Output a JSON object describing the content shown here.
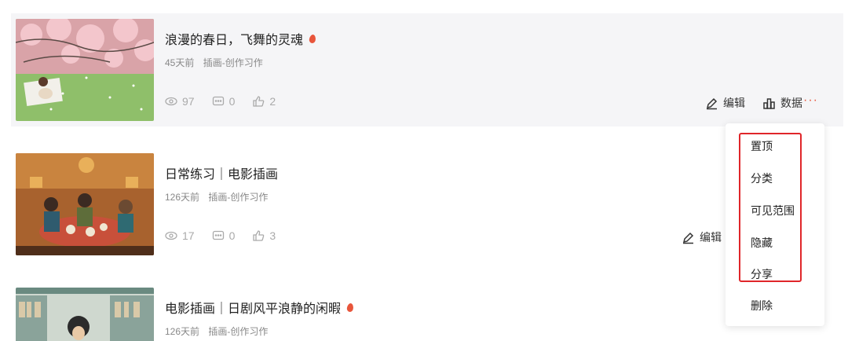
{
  "colors": {
    "accent": "#e8553b",
    "highlight_box": "#e0262a",
    "hover_bg": "#f5f5f7"
  },
  "works": [
    {
      "title": "浪漫的春日，飞舞的灵魂",
      "has_badge": true,
      "time": "45天前",
      "category": "插画-创作习作",
      "views": "97",
      "comments": "0",
      "likes": "2",
      "thumb_icon": "illustration-cherry-blossom"
    },
    {
      "title": "日常练习｜电影插画",
      "has_badge": false,
      "time": "126天前",
      "category": "插画-创作习作",
      "views": "17",
      "comments": "0",
      "likes": "3",
      "thumb_icon": "illustration-dinner-table"
    },
    {
      "title": "电影插画｜日剧风平浪静的闲暇",
      "has_badge": true,
      "time": "126天前",
      "category": "插画-创作习作",
      "thumb_icon": "illustration-bookstore"
    }
  ],
  "actions": {
    "edit": "编辑",
    "data": "数据",
    "more": "···",
    "edit_partial": "编辑"
  },
  "menu": {
    "items": [
      "置顶",
      "分类",
      "可见范围",
      "隐藏",
      "分享",
      "删除"
    ]
  }
}
